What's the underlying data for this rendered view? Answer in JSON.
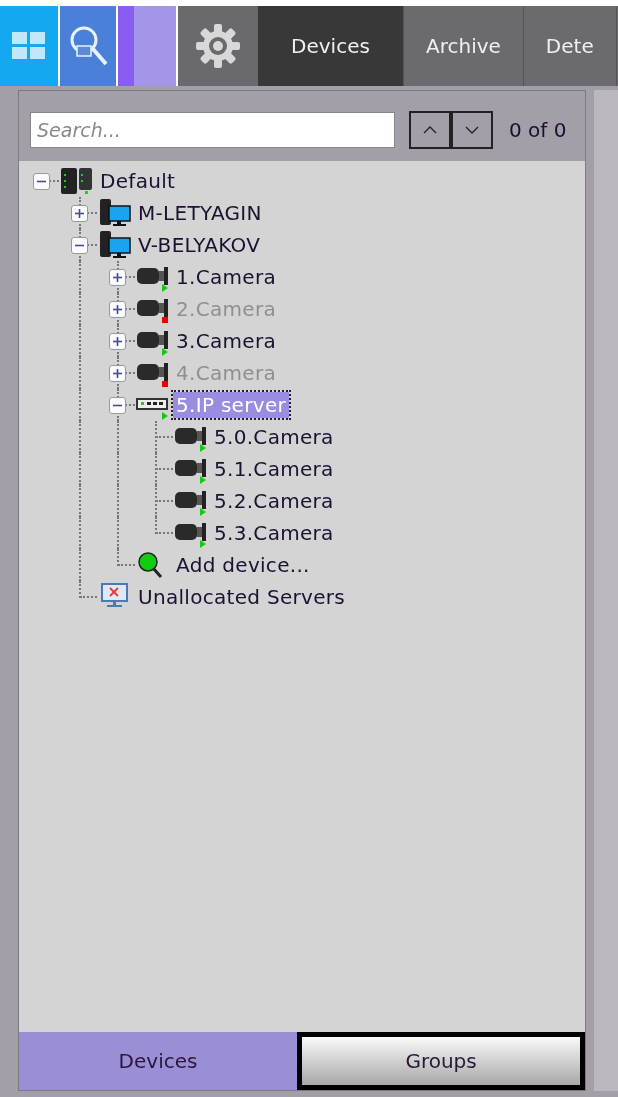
{
  "top_tabs": [
    {
      "label": "Devices",
      "selected": true
    },
    {
      "label": "Archive",
      "selected": false
    },
    {
      "label": "Dete",
      "selected": false
    }
  ],
  "search": {
    "placeholder": "Search...",
    "match_count": "0 of 0"
  },
  "tree": [
    {
      "kind": "server-group",
      "label": "Default",
      "expanded": true,
      "children": [
        {
          "kind": "computer",
          "label": "M-LETYAGIN",
          "expanded": false
        },
        {
          "kind": "computer",
          "label": "V-BELYAKOV",
          "expanded": true,
          "children": [
            {
              "kind": "camera",
              "label": "1.Camera",
              "expanded": false,
              "online": true,
              "disabled": false,
              "selected": false
            },
            {
              "kind": "camera",
              "label": "2.Camera",
              "expanded": false,
              "online": false,
              "disabled": true,
              "selected": false
            },
            {
              "kind": "camera",
              "label": "3.Camera",
              "expanded": false,
              "online": true,
              "disabled": false,
              "selected": false
            },
            {
              "kind": "camera",
              "label": "4.Camera",
              "expanded": false,
              "online": false,
              "disabled": true,
              "selected": false
            },
            {
              "kind": "ip-server",
              "label": "5.IP server",
              "expanded": true,
              "online": true,
              "disabled": false,
              "selected": true,
              "children": [
                {
                  "kind": "camera",
                  "label": "5.0.Camera",
                  "online": true,
                  "disabled": false,
                  "selected": false
                },
                {
                  "kind": "camera",
                  "label": "5.1.Camera",
                  "online": true,
                  "disabled": false,
                  "selected": false
                },
                {
                  "kind": "camera",
                  "label": "5.2.Camera",
                  "online": true,
                  "disabled": false,
                  "selected": false
                },
                {
                  "kind": "camera",
                  "label": "5.3.Camera",
                  "online": true,
                  "disabled": false,
                  "selected": false
                }
              ]
            },
            {
              "kind": "add",
              "label": "Add device..."
            }
          ]
        },
        {
          "kind": "unallocated",
          "label": "Unallocated Servers"
        }
      ]
    }
  ],
  "bottom_tabs": [
    {
      "label": "Devices",
      "selected": true
    },
    {
      "label": "Groups",
      "selected": false
    }
  ]
}
